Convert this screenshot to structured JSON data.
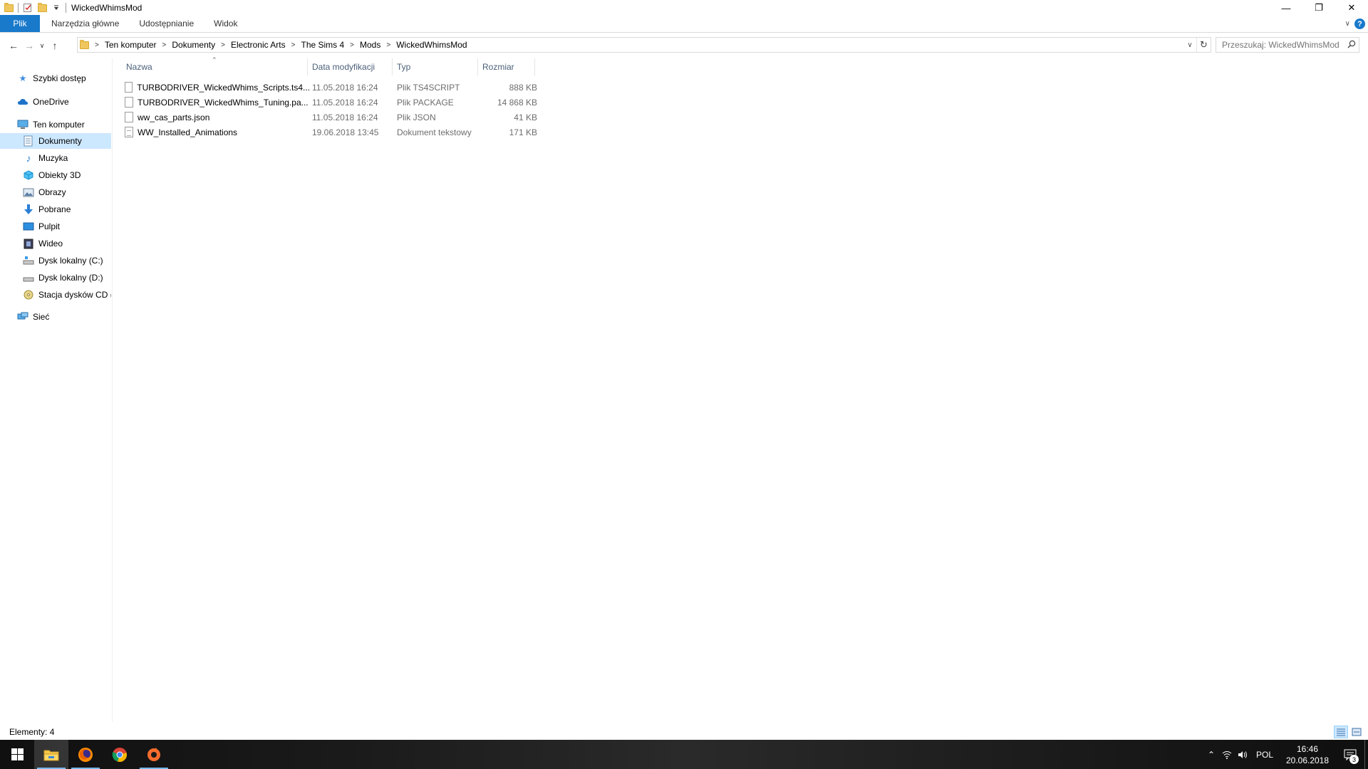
{
  "window": {
    "title": "WickedWhimsMod",
    "controls": {
      "minimize": "—",
      "maximize": "❐",
      "close": "✕"
    }
  },
  "ribbon": {
    "tabs": [
      "Plik",
      "Narzędzia główne",
      "Udostępnianie",
      "Widok"
    ],
    "help": "?"
  },
  "address": {
    "crumbs": [
      "Ten komputer",
      "Dokumenty",
      "Electronic Arts",
      "The Sims 4",
      "Mods",
      "WickedWhimsMod"
    ]
  },
  "search": {
    "placeholder": "Przeszukaj: WickedWhimsMod"
  },
  "navpane": {
    "items": [
      {
        "label": "Szybki dostęp",
        "icon": "star-icon"
      },
      {
        "label": "OneDrive",
        "icon": "cloud-icon"
      },
      {
        "label": "Ten komputer",
        "icon": "computer-icon"
      },
      {
        "label": "Dokumenty",
        "icon": "documents-icon"
      },
      {
        "label": "Muzyka",
        "icon": "music-icon"
      },
      {
        "label": "Obiekty 3D",
        "icon": "cube-icon"
      },
      {
        "label": "Obrazy",
        "icon": "pictures-icon"
      },
      {
        "label": "Pobrane",
        "icon": "download-icon"
      },
      {
        "label": "Pulpit",
        "icon": "desktop-icon"
      },
      {
        "label": "Wideo",
        "icon": "video-icon"
      },
      {
        "label": "Dysk lokalny (C:)",
        "icon": "drive-icon"
      },
      {
        "label": "Dysk lokalny (D:)",
        "icon": "drive-icon"
      },
      {
        "label": "Stacja dysków CD (E",
        "icon": "cd-drive-icon"
      },
      {
        "label": "Sieć",
        "icon": "network-icon"
      }
    ]
  },
  "columns": {
    "name": "Nazwa",
    "modified": "Data modyfikacji",
    "type": "Typ",
    "size": "Rozmiar"
  },
  "files": [
    {
      "name": "TURBODRIVER_WickedWhims_Scripts.ts4...",
      "modified": "11.05.2018 16:24",
      "type": "Plik TS4SCRIPT",
      "size": "888 KB"
    },
    {
      "name": "TURBODRIVER_WickedWhims_Tuning.pa...",
      "modified": "11.05.2018 16:24",
      "type": "Plik PACKAGE",
      "size": "14 868 KB"
    },
    {
      "name": "ww_cas_parts.json",
      "modified": "11.05.2018 16:24",
      "type": "Plik JSON",
      "size": "41 KB"
    },
    {
      "name": "WW_Installed_Animations",
      "modified": "19.06.2018 13:45",
      "type": "Dokument tekstowy",
      "size": "171 KB"
    }
  ],
  "status": {
    "count": "Elementy: 4"
  },
  "taskbar": {
    "lang": "POL",
    "time": "16:46",
    "date": "20.06.2018",
    "notifications": "3"
  }
}
